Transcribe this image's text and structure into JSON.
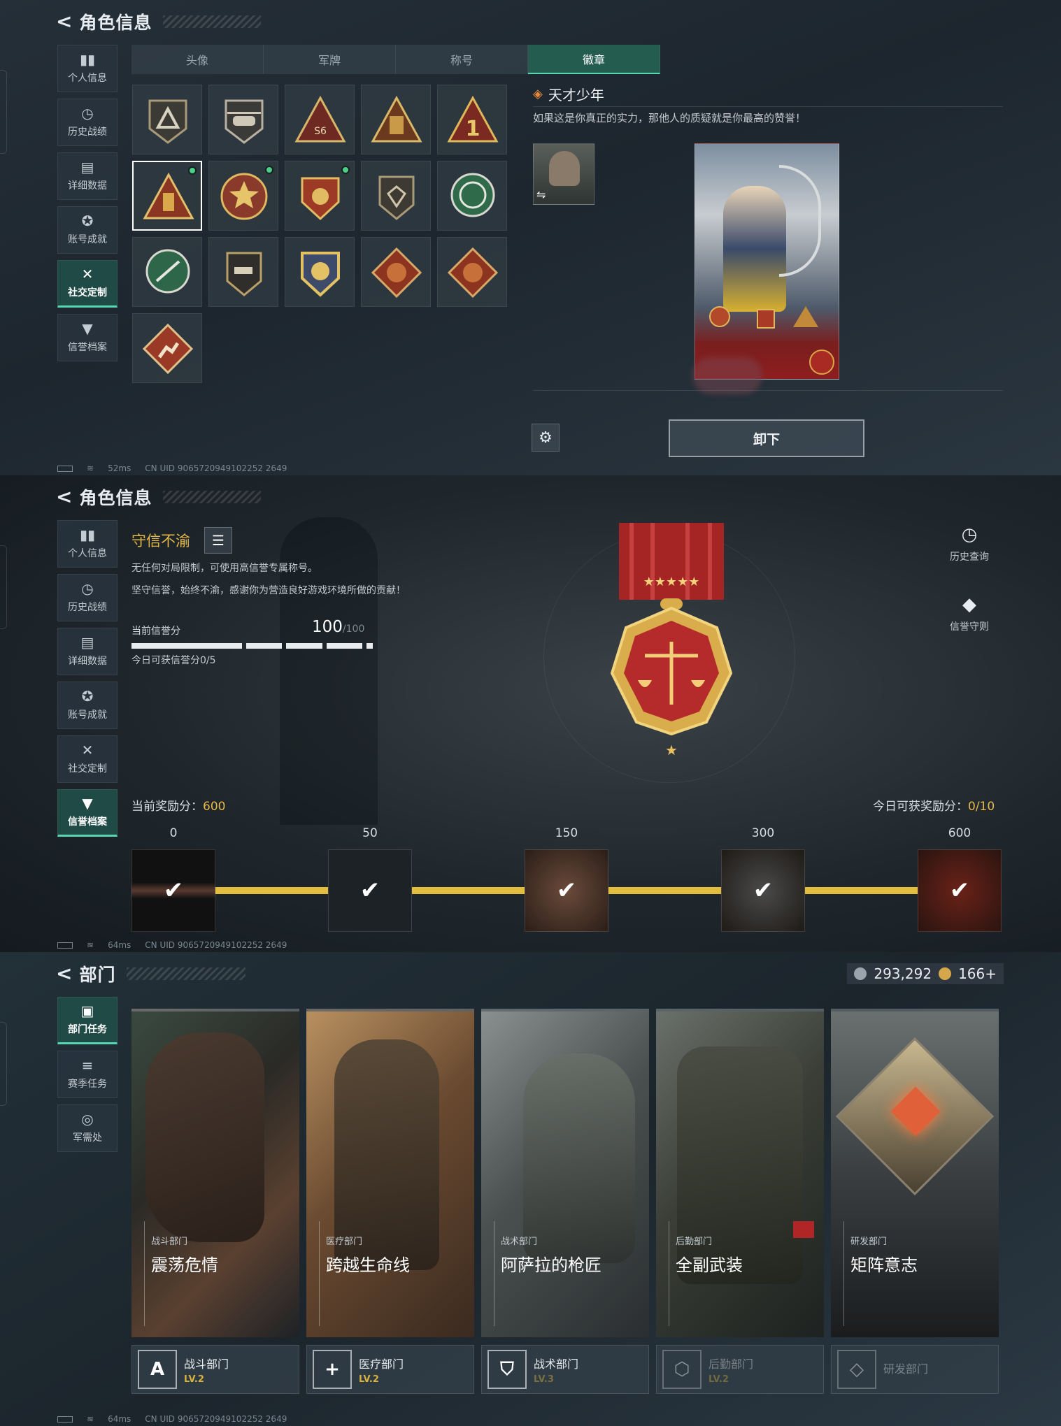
{
  "panel1": {
    "header": {
      "title": "角色信息"
    },
    "sidebar": [
      {
        "label": "个人信息",
        "icon": "bar-chart-icon"
      },
      {
        "label": "历史战绩",
        "icon": "clock-icon"
      },
      {
        "label": "详细数据",
        "icon": "folder-icon"
      },
      {
        "label": "账号成就",
        "icon": "medal-icon"
      },
      {
        "label": "社交定制",
        "icon": "tools-icon",
        "active": true
      },
      {
        "label": "信誉档案",
        "icon": "shield-icon"
      }
    ],
    "tabs": [
      {
        "label": "头像"
      },
      {
        "label": "军牌"
      },
      {
        "label": "称号"
      },
      {
        "label": "徽章",
        "active": true
      }
    ],
    "badge_title": "天才少年",
    "badge_desc": "如果这是你真正的实力，那他人的质疑就是你最高的赞誉！",
    "unequip_label": "卸下",
    "status": {
      "ping": "52ms",
      "uid": "CN UID 9065720949102252 2649"
    }
  },
  "panel2": {
    "header": {
      "title": "角色信息"
    },
    "sidebar": [
      {
        "label": "个人信息",
        "icon": "bar-chart-icon"
      },
      {
        "label": "历史战绩",
        "icon": "clock-icon"
      },
      {
        "label": "详细数据",
        "icon": "folder-icon"
      },
      {
        "label": "账号成就",
        "icon": "medal-icon"
      },
      {
        "label": "社交定制",
        "icon": "tools-icon"
      },
      {
        "label": "信誉档案",
        "icon": "shield-icon",
        "active": true
      }
    ],
    "honor_title": "守信不渝",
    "line1": "无任何对局限制，可使用高信誉专属称号。",
    "line2": "坚守信誉，始终不渝，感谢你为营造良好游戏环境所做的贡献！",
    "score_label": "当前信誉分",
    "score_value": "100",
    "score_max": "/100",
    "score_progress": 1.0,
    "daily_label": "今日可获信誉分0/5",
    "history_label": "历史查询",
    "rules_label": "信誉守则",
    "reward_label": "当前奖励分：",
    "reward_value": "600",
    "daily_reward_label": "今日可获奖励分：",
    "daily_reward_value": "0/10",
    "milestones": [
      "0",
      "50",
      "150",
      "300",
      "600"
    ],
    "status": {
      "ping": "64ms",
      "uid": "CN UID 9065720949102252 2649"
    }
  },
  "panel3": {
    "header": {
      "title": "部门"
    },
    "currency1": "293,292",
    "currency2": "166+",
    "sidebar": [
      {
        "label": "部门任务",
        "icon": "document-icon",
        "active": true
      },
      {
        "label": "赛季任务",
        "icon": "stack-icon"
      },
      {
        "label": "军需处",
        "icon": "coins-icon"
      }
    ],
    "cards": [
      {
        "sub": "战斗部门",
        "name": "震荡危情"
      },
      {
        "sub": "医疗部门",
        "name": "跨越生命线"
      },
      {
        "sub": "战术部门",
        "name": "阿萨拉的枪匠"
      },
      {
        "sub": "后勤部门",
        "name": "全副武装"
      },
      {
        "sub": "研发部门",
        "name": "矩阵意志"
      }
    ],
    "departments": [
      {
        "name": "战斗部门",
        "level": "LV.2"
      },
      {
        "name": "医疗部门",
        "level": "LV.2"
      },
      {
        "name": "战术部门",
        "level": "LV.3"
      },
      {
        "name": "后勤部门",
        "level": "LV.2"
      },
      {
        "name": "研发部门",
        "level": ""
      }
    ],
    "status": {
      "ping": "64ms",
      "uid": "CN UID 9065720949102252 2649"
    }
  }
}
